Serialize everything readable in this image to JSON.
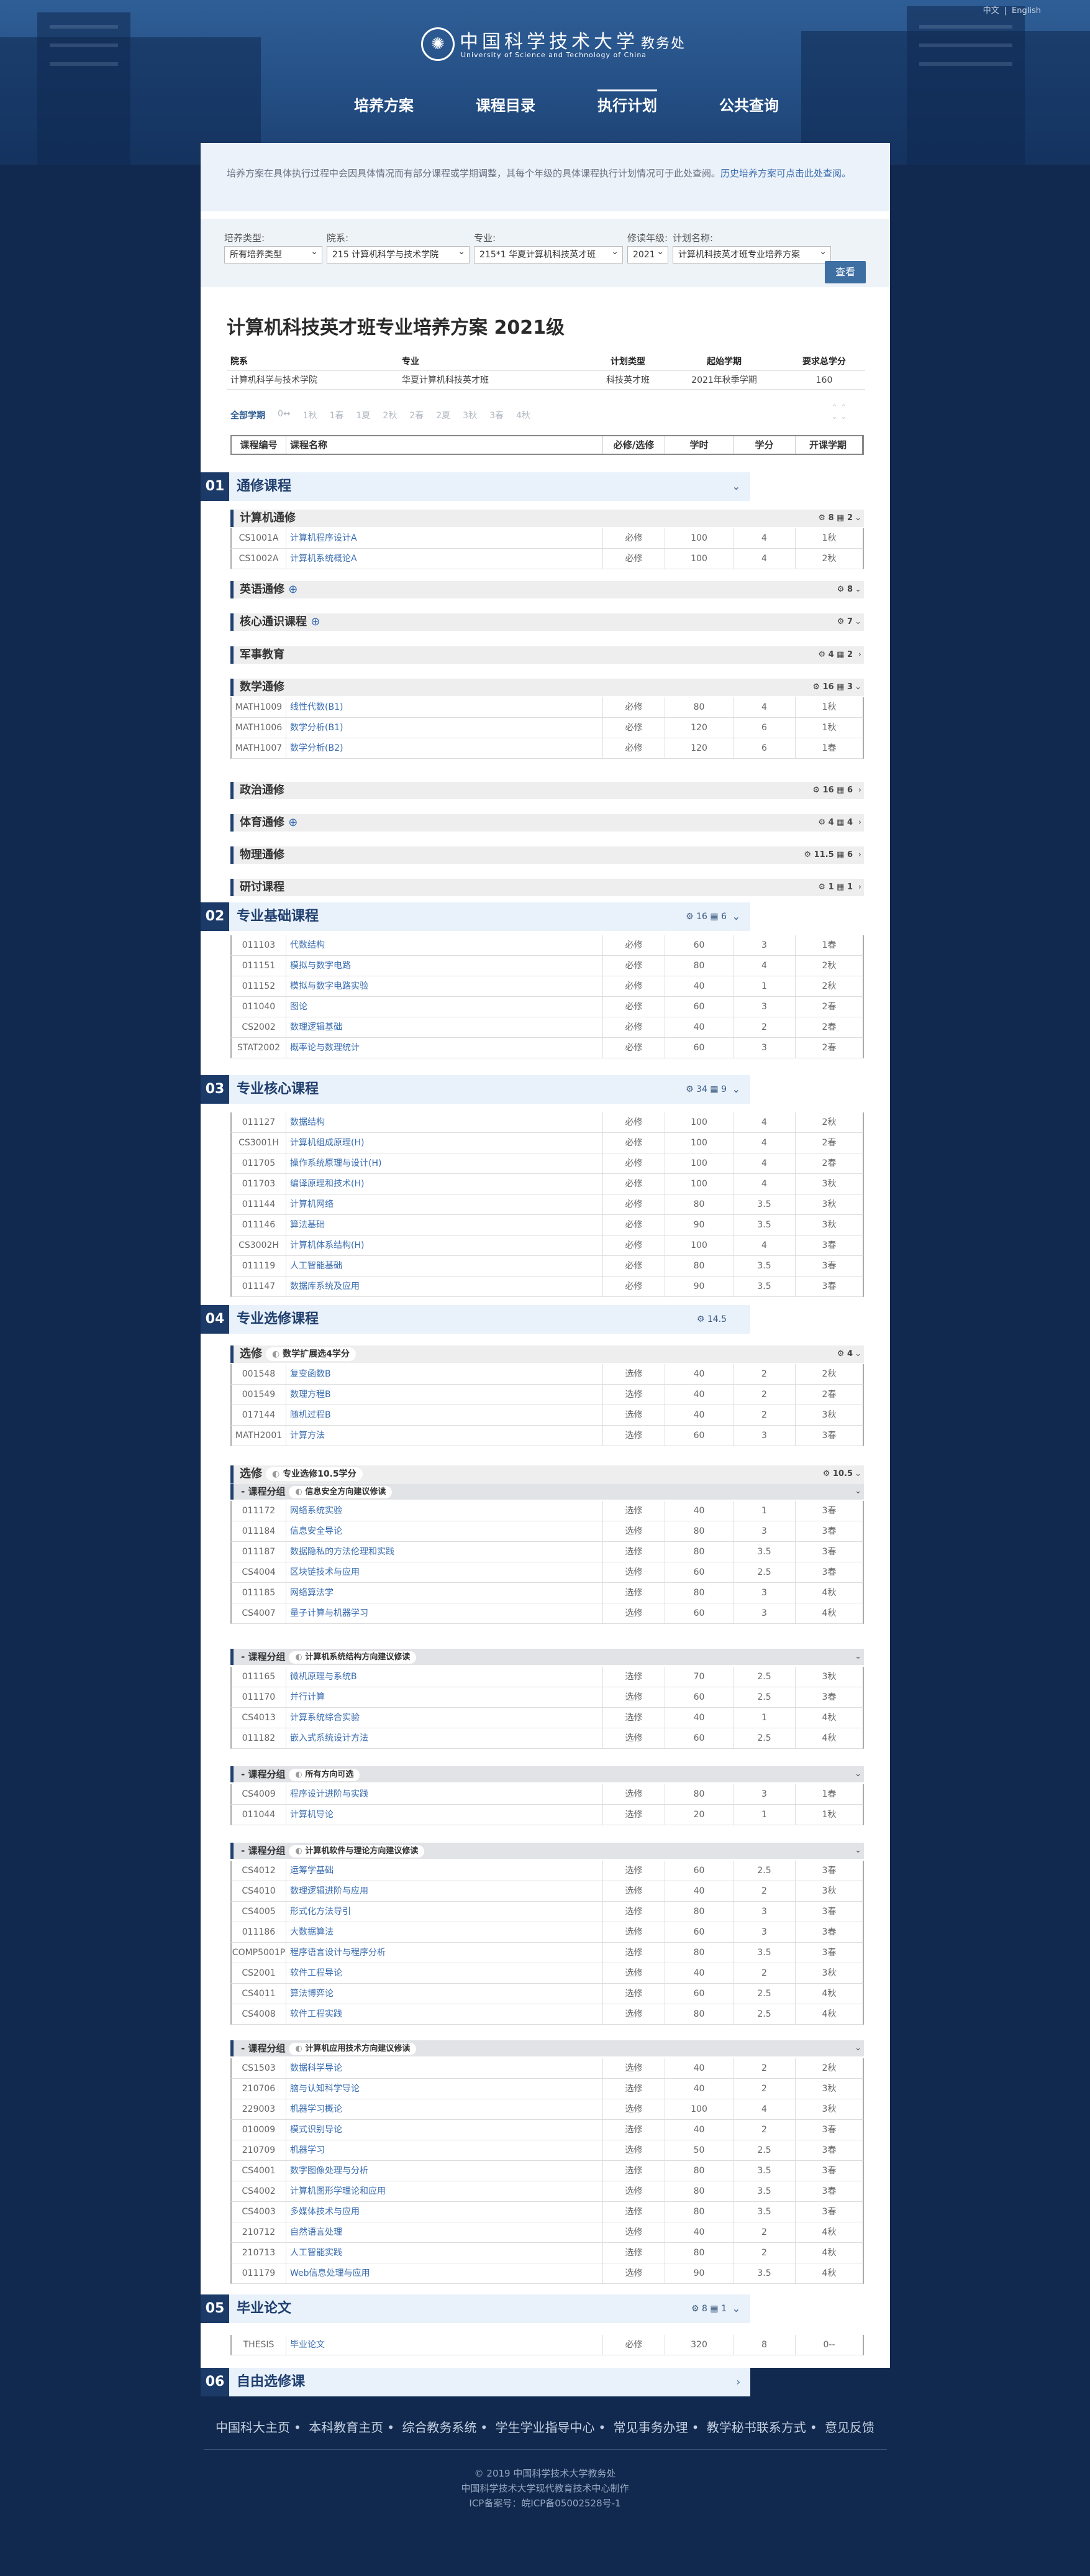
{
  "lang": {
    "cn": "中文",
    "sep": "|",
    "en": "English"
  },
  "brand": {
    "cn": "中国科学技术大学",
    "unit": "教务处",
    "en": "University of Science and Technology of China"
  },
  "nav": [
    "培养方案",
    "课程目录",
    "执行计划",
    "公共查询"
  ],
  "intro": {
    "text": "培养方案在具体执行过程中会因具体情况而有部分课程或学期调整，其每个年级的具体课程执行计划情况可于此处查阅。",
    "link": "历史培养方案可点击此处查阅。"
  },
  "filters": {
    "type": {
      "label": "培养类型:",
      "value": "所有培养类型"
    },
    "dept": {
      "label": "院系:",
      "value": "215 计算机科学与技术学院"
    },
    "major": {
      "label": "专业:",
      "value": "215*1 华夏计算机科技英才班"
    },
    "year": {
      "label": "修读年级:",
      "value": "2021"
    },
    "plan": {
      "label": "计划名称:",
      "value": "计算机科技英才班专业培养方案"
    },
    "query": "查看"
  },
  "title": "计算机科技英才班专业培养方案 2021级",
  "meta": {
    "headers": [
      "院系",
      "专业",
      "计划类型",
      "起始学期",
      "要求总学分"
    ],
    "values": [
      "计算机科学与技术学院",
      "华夏计算机科技英才班",
      "科技英才班",
      "2021年秋季学期",
      "160"
    ]
  },
  "terms": [
    "全部学期",
    "0↔",
    "1秋",
    "1春",
    "1夏",
    "2秋",
    "2春",
    "2夏",
    "3秋",
    "3春",
    "4秋"
  ],
  "table_header": [
    "课程编号",
    "课程名称",
    "必修/选修",
    "学时",
    "学分",
    "开课学期"
  ],
  "s01": {
    "num": "01",
    "name": "通修课程",
    "chev": "⌄"
  },
  "g_cs": {
    "name": "计算机通修",
    "stats": "⚙ 8  ▦ 2",
    "chev": "⌄"
  },
  "cs": [
    [
      "CS1001A",
      "计算机程序设计A",
      "必修",
      "100",
      "4",
      "1秋"
    ],
    [
      "CS1002A",
      "计算机系统概论A",
      "必修",
      "100",
      "4",
      "2秋"
    ]
  ],
  "g_en": {
    "name": "英语通修",
    "plus": "⊕",
    "stats": "⚙ 8",
    "chev": "⌄"
  },
  "g_core": {
    "name": "核心通识课程",
    "plus": "⊕",
    "stats": "⚙ 7",
    "chev": "⌄"
  },
  "g_mil": {
    "name": "军事教育",
    "stats": "⚙ 4  ▦ 2",
    "chev": "›"
  },
  "g_math": {
    "name": "数学通修",
    "stats": "⚙ 16  ▦ 3",
    "chev": "⌄"
  },
  "math": [
    [
      "MATH1009",
      "线性代数(B1)",
      "必修",
      "80",
      "4",
      "1秋"
    ],
    [
      "MATH1006",
      "数学分析(B1)",
      "必修",
      "120",
      "6",
      "1秋"
    ],
    [
      "MATH1007",
      "数学分析(B2)",
      "必修",
      "120",
      "6",
      "1春"
    ]
  ],
  "g_pol": {
    "name": "政治通修",
    "stats": "⚙ 16  ▦ 6",
    "chev": "›"
  },
  "g_pe": {
    "name": "体育通修",
    "plus": "⊕",
    "stats": "⚙ 4  ▦ 4",
    "chev": "›"
  },
  "g_phy": {
    "name": "物理通修",
    "stats": "⚙ 11.5  ▦ 6",
    "chev": "›"
  },
  "g_sem": {
    "name": "研讨课程",
    "stats": "⚙ 1  ▦ 1",
    "chev": "›"
  },
  "s02": {
    "num": "02",
    "name": "专业基础课程",
    "stats": "⚙ 16  ▦ 6",
    "chev": "⌄"
  },
  "found": [
    [
      "011103",
      "代数结构",
      "必修",
      "60",
      "3",
      "1春"
    ],
    [
      "011151",
      "模拟与数字电路",
      "必修",
      "80",
      "4",
      "2秋"
    ],
    [
      "011152",
      "模拟与数字电路实验",
      "必修",
      "40",
      "1",
      "2秋"
    ],
    [
      "011040",
      "图论",
      "必修",
      "60",
      "3",
      "2春"
    ],
    [
      "CS2002",
      "数理逻辑基础",
      "必修",
      "40",
      "2",
      "2春"
    ],
    [
      "STAT2002",
      "概率论与数理统计",
      "必修",
      "60",
      "3",
      "2春"
    ]
  ],
  "s03": {
    "num": "03",
    "name": "专业核心课程",
    "stats": "⚙ 34  ▦ 9",
    "chev": "⌄"
  },
  "core": [
    [
      "011127",
      "数据结构",
      "必修",
      "100",
      "4",
      "2秋"
    ],
    [
      "CS3001H",
      "计算机组成原理(H)",
      "必修",
      "100",
      "4",
      "2春"
    ],
    [
      "011705",
      "操作系统原理与设计(H)",
      "必修",
      "100",
      "4",
      "2春"
    ],
    [
      "011703",
      "编译原理和技术(H)",
      "必修",
      "100",
      "4",
      "3秋"
    ],
    [
      "011144",
      "计算机网络",
      "必修",
      "80",
      "3.5",
      "3秋"
    ],
    [
      "011146",
      "算法基础",
      "必修",
      "90",
      "3.5",
      "3秋"
    ],
    [
      "CS3002H",
      "计算机体系结构(H)",
      "必修",
      "100",
      "4",
      "3春"
    ],
    [
      "011119",
      "人工智能基础",
      "必修",
      "80",
      "3.5",
      "3春"
    ],
    [
      "011147",
      "数据库系统及应用",
      "必修",
      "90",
      "3.5",
      "3春"
    ]
  ],
  "s04": {
    "num": "04",
    "name": "专业选修课程",
    "stats": "⚙ 14.5",
    "chev": ""
  },
  "e1": {
    "name": "选修",
    "tag": "数学扩展选4学分",
    "stats": "⚙ 4",
    "chev": "⌄"
  },
  "e1rows": [
    [
      "001548",
      "复变函数B",
      "选修",
      "40",
      "2",
      "2秋"
    ],
    [
      "001549",
      "数理方程B",
      "选修",
      "40",
      "2",
      "2春"
    ],
    [
      "017144",
      "随机过程B",
      "选修",
      "40",
      "2",
      "3秋"
    ],
    [
      "MATH2001",
      "计算方法",
      "选修",
      "60",
      "3",
      "3春"
    ]
  ],
  "e2": {
    "name": "选修",
    "tag": "专业选修10.5学分",
    "stats": "⚙ 10.5",
    "chev": "⌄"
  },
  "sg1": {
    "name": "- 课程分组",
    "tag": "信息安全方向建议修读",
    "chev": "⌄"
  },
  "sg1rows": [
    [
      "011172",
      "网络系统实验",
      "选修",
      "40",
      "1",
      "3春"
    ],
    [
      "011184",
      "信息安全导论",
      "选修",
      "80",
      "3",
      "3春"
    ],
    [
      "011187",
      "数据隐私的方法伦理和实践",
      "选修",
      "80",
      "3.5",
      "3春"
    ],
    [
      "CS4004",
      "区块链技术与应用",
      "选修",
      "60",
      "2.5",
      "3春"
    ],
    [
      "011185",
      "网络算法学",
      "选修",
      "80",
      "3",
      "4秋"
    ],
    [
      "CS4007",
      "量子计算与机器学习",
      "选修",
      "60",
      "3",
      "4秋"
    ]
  ],
  "sg2": {
    "name": "- 课程分组",
    "tag": "计算机系统结构方向建议修读",
    "chev": "⌄"
  },
  "sg2rows": [
    [
      "011165",
      "微机原理与系统B",
      "选修",
      "70",
      "2.5",
      "3秋"
    ],
    [
      "011170",
      "并行计算",
      "选修",
      "60",
      "2.5",
      "3春"
    ],
    [
      "CS4013",
      "计算系统综合实验",
      "选修",
      "40",
      "1",
      "4秋"
    ],
    [
      "011182",
      "嵌入式系统设计方法",
      "选修",
      "60",
      "2.5",
      "4秋"
    ]
  ],
  "sg3": {
    "name": "- 课程分组",
    "tag": "所有方向可选",
    "chev": "⌄"
  },
  "sg3rows": [
    [
      "CS4009",
      "程序设计进阶与实践",
      "选修",
      "80",
      "3",
      "1春"
    ],
    [
      "011044",
      "计算机导论",
      "选修",
      "20",
      "1",
      "1秋"
    ]
  ],
  "sg4": {
    "name": "- 课程分组",
    "tag": "计算机软件与理论方向建议修读",
    "chev": "⌄"
  },
  "sg4rows": [
    [
      "CS4012",
      "运筹学基础",
      "选修",
      "60",
      "2.5",
      "3春"
    ],
    [
      "CS4010",
      "数理逻辑进阶与应用",
      "选修",
      "40",
      "2",
      "3秋"
    ],
    [
      "CS4005",
      "形式化方法导引",
      "选修",
      "80",
      "3",
      "3春"
    ],
    [
      "011186",
      "大数据算法",
      "选修",
      "60",
      "3",
      "3春"
    ],
    [
      "COMP5001P",
      "程序语言设计与程序分析",
      "选修",
      "80",
      "3.5",
      "3春"
    ],
    [
      "CS2001",
      "软件工程导论",
      "选修",
      "40",
      "2",
      "3秋"
    ],
    [
      "CS4011",
      "算法博弈论",
      "选修",
      "60",
      "2.5",
      "4秋"
    ],
    [
      "CS4008",
      "软件工程实践",
      "选修",
      "80",
      "2.5",
      "4秋"
    ]
  ],
  "sg5": {
    "name": "- 课程分组",
    "tag": "计算机应用技术方向建议修读",
    "chev": "⌄"
  },
  "sg5rows": [
    [
      "CS1503",
      "数据科学导论",
      "选修",
      "40",
      "2",
      "2秋"
    ],
    [
      "210706",
      "脑与认知科学导论",
      "选修",
      "40",
      "2",
      "3秋"
    ],
    [
      "229003",
      "机器学习概论",
      "选修",
      "100",
      "4",
      "3秋"
    ],
    [
      "010009",
      "模式识别导论",
      "选修",
      "40",
      "2",
      "3春"
    ],
    [
      "210709",
      "机器学习",
      "选修",
      "50",
      "2.5",
      "3春"
    ],
    [
      "CS4001",
      "数字图像处理与分析",
      "选修",
      "80",
      "3.5",
      "3春"
    ],
    [
      "CS4002",
      "计算机图形学理论和应用",
      "选修",
      "80",
      "3.5",
      "3春"
    ],
    [
      "CS4003",
      "多媒体技术与应用",
      "选修",
      "80",
      "3.5",
      "3春"
    ],
    [
      "210712",
      "自然语言处理",
      "选修",
      "40",
      "2",
      "4秋"
    ],
    [
      "210713",
      "人工智能实践",
      "选修",
      "80",
      "2",
      "4秋"
    ],
    [
      "011179",
      "Web信息处理与应用",
      "选修",
      "90",
      "3.5",
      "4秋"
    ]
  ],
  "s05": {
    "num": "05",
    "name": "毕业论文",
    "stats": "⚙ 8  ▦ 1",
    "chev": "⌄"
  },
  "thesis": [
    [
      "THESIS",
      "毕业论文",
      "必修",
      "320",
      "8",
      "0--"
    ]
  ],
  "s06": {
    "num": "06",
    "name": "自由选修课",
    "chev": "›"
  },
  "footer": {
    "links": [
      "中国科大主页",
      "本科教育主页",
      "综合教务系统",
      "学生学业指导中心",
      "常见事务办理",
      "教学秘书联系方式",
      "意见反馈"
    ],
    "copy1": "© 2019 中国科学技术大学教务处",
    "copy2": "中国科学技术大学现代教育技术中心制作",
    "copy3": "ICP备案号：皖ICP备05002528号-1"
  },
  "colors": {
    "navy": "#1b3a68",
    "accent": "#3a6db0",
    "section_bg": "#e9f1fb"
  }
}
